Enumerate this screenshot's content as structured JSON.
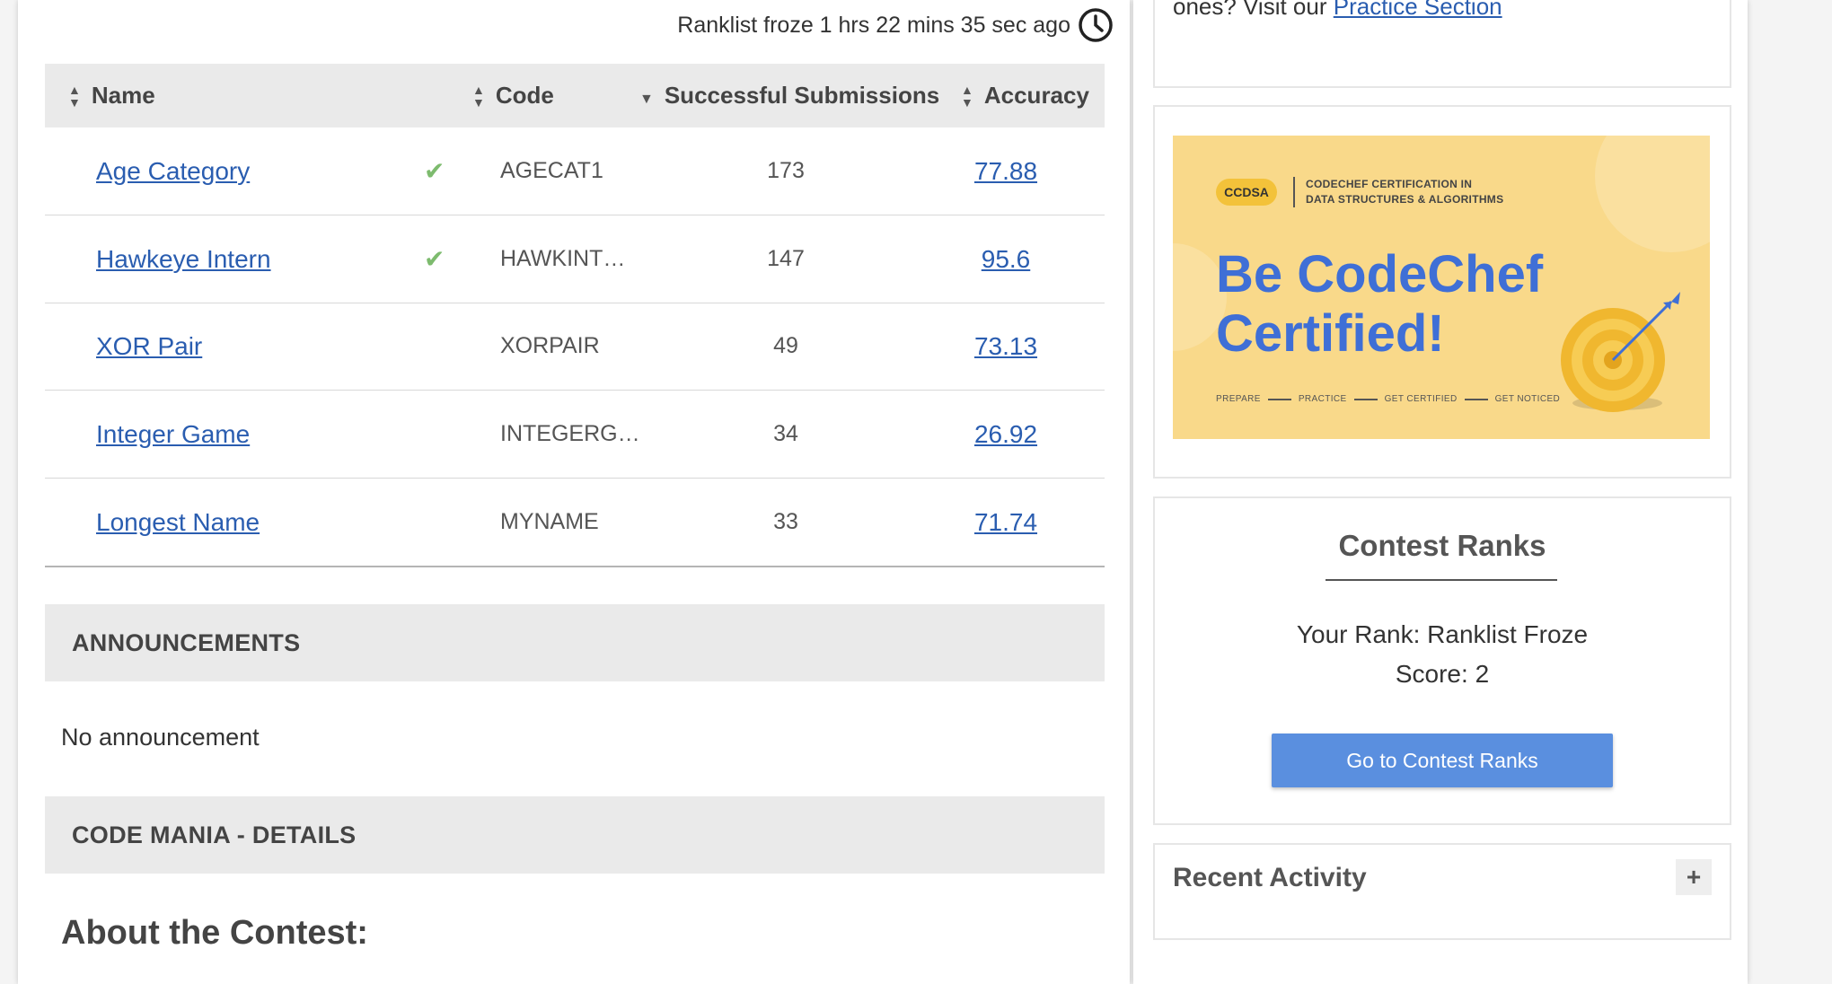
{
  "ranklist": {
    "freeze_text": "Ranklist froze 1 hrs 22 mins 35 sec ago"
  },
  "table": {
    "headers": {
      "name": "Name",
      "code": "Code",
      "submissions": "Successful Submissions",
      "accuracy": "Accuracy"
    },
    "rows": [
      {
        "name": "Age Category",
        "solved": true,
        "code": "AGECAT1",
        "submissions": "173",
        "accuracy": "77.88"
      },
      {
        "name": "Hawkeye Intern",
        "solved": true,
        "code": "HAWKINT…",
        "submissions": "147",
        "accuracy": "95.6"
      },
      {
        "name": "XOR Pair",
        "solved": false,
        "code": "XORPAIR",
        "submissions": "49",
        "accuracy": "73.13"
      },
      {
        "name": "Integer Game",
        "solved": false,
        "code": "INTEGERG…",
        "submissions": "34",
        "accuracy": "26.92"
      },
      {
        "name": "Longest Name",
        "solved": false,
        "code": "MYNAME",
        "submissions": "33",
        "accuracy": "71.74"
      }
    ]
  },
  "announcements": {
    "title": "ANNOUNCEMENTS",
    "text": "No announcement"
  },
  "details": {
    "title": "CODE MANIA - DETAILS",
    "about": "About the Contest:"
  },
  "practice": {
    "prefix": "ones? Visit our ",
    "link": "Practice Section"
  },
  "banner": {
    "badge": "CCDSA",
    "cert_line1": "CODECHEF CERTIFICATION IN",
    "cert_line2": "DATA STRUCTURES & ALGORITHMS",
    "headline1": "Be CodeChef",
    "headline2": "Certified!",
    "steps": [
      "PREPARE",
      "PRACTICE",
      "GET CERTIFIED",
      "GET NOTICED"
    ]
  },
  "contest_ranks": {
    "title": "Contest Ranks",
    "your_rank": "Your Rank: Ranklist Froze",
    "score": "Score: 2",
    "button": "Go to Contest Ranks"
  },
  "recent_activity": {
    "title": "Recent Activity",
    "toggle": "+"
  },
  "colors": {
    "link": "#2a5db0",
    "button": "#5a8fdf",
    "check": "#7dbb6e",
    "banner_bg": "#f9d98a",
    "headline": "#3f6fd6"
  }
}
